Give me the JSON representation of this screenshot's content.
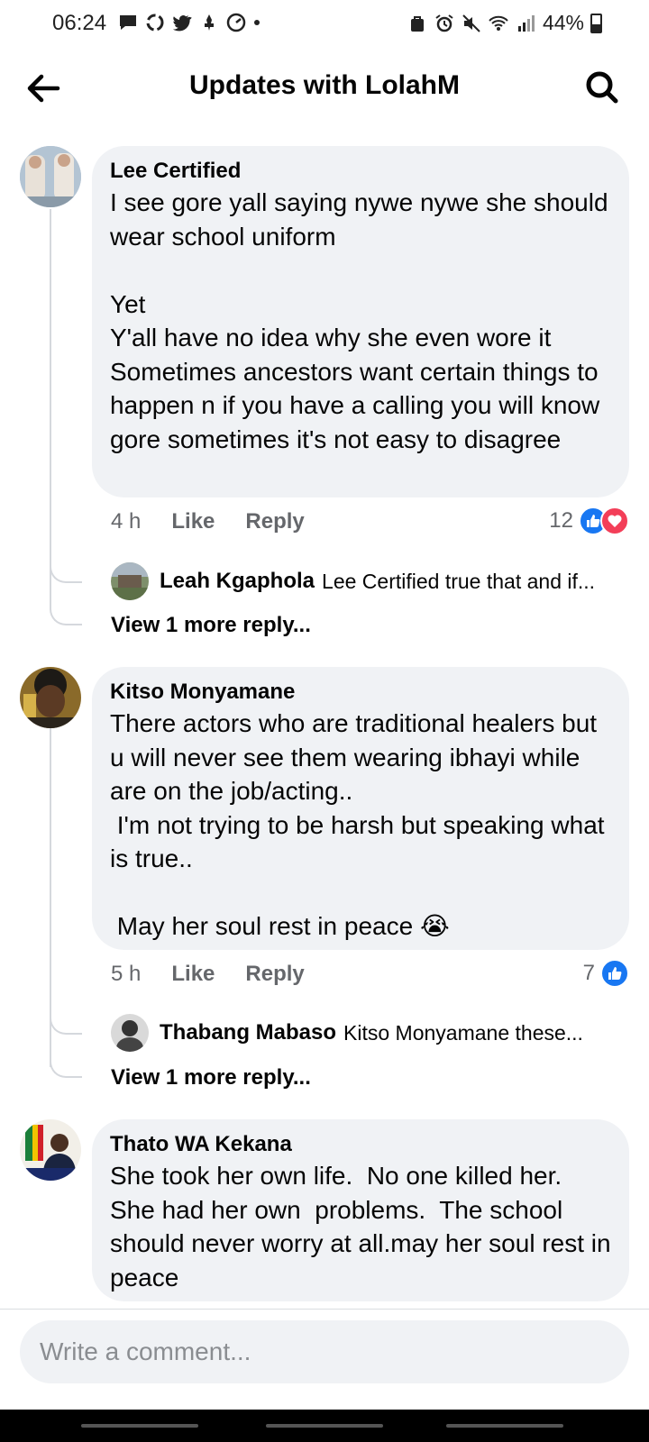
{
  "status_bar": {
    "time": "06:24",
    "battery_percent": "44%",
    "battery_level": 0.44
  },
  "header": {
    "title": "Updates with LolahM"
  },
  "comments": [
    {
      "author": "Lee Certified",
      "text": "I see gore yall saying nywe nywe she should wear school uniform\n\nYet\nY'all have no idea why she even wore it Sometimes ancestors want certain things to happen n if you have a calling you will know gore sometimes it's not easy to disagree",
      "time": "4 h",
      "like_label": "Like",
      "reply_label": "Reply",
      "reaction_count": "12",
      "reactions": [
        "like",
        "love"
      ],
      "reply": {
        "author": "Leah Kgaphola",
        "snippet": "Lee Certified true that and if..."
      },
      "more_replies": "View 1 more reply..."
    },
    {
      "author": "Kitso Monyamane",
      "text": "There actors who are traditional healers but u will never see them wearing ibhayi while are on the job/acting..\n I'm not trying to be harsh but speaking what is true..\n\n May her soul rest in peace 😭",
      "time": "5 h",
      "like_label": "Like",
      "reply_label": "Reply",
      "reaction_count": "7",
      "reactions": [
        "like"
      ],
      "reply": {
        "author": "Thabang Mabaso",
        "snippet": "Kitso Monyamane these..."
      },
      "more_replies": "View 1 more reply..."
    },
    {
      "author": "Thato WA Kekana",
      "text": "She took her own life.  No one killed her.  She had her own  problems.  The school should never worry at all.may her soul rest in peace"
    }
  ],
  "composer": {
    "placeholder": "Write a comment..."
  },
  "colors": {
    "bubble": "#f0f2f5",
    "like_blue": "#1877f2",
    "love_red": "#f33e58",
    "meta_gray": "#65676b"
  }
}
